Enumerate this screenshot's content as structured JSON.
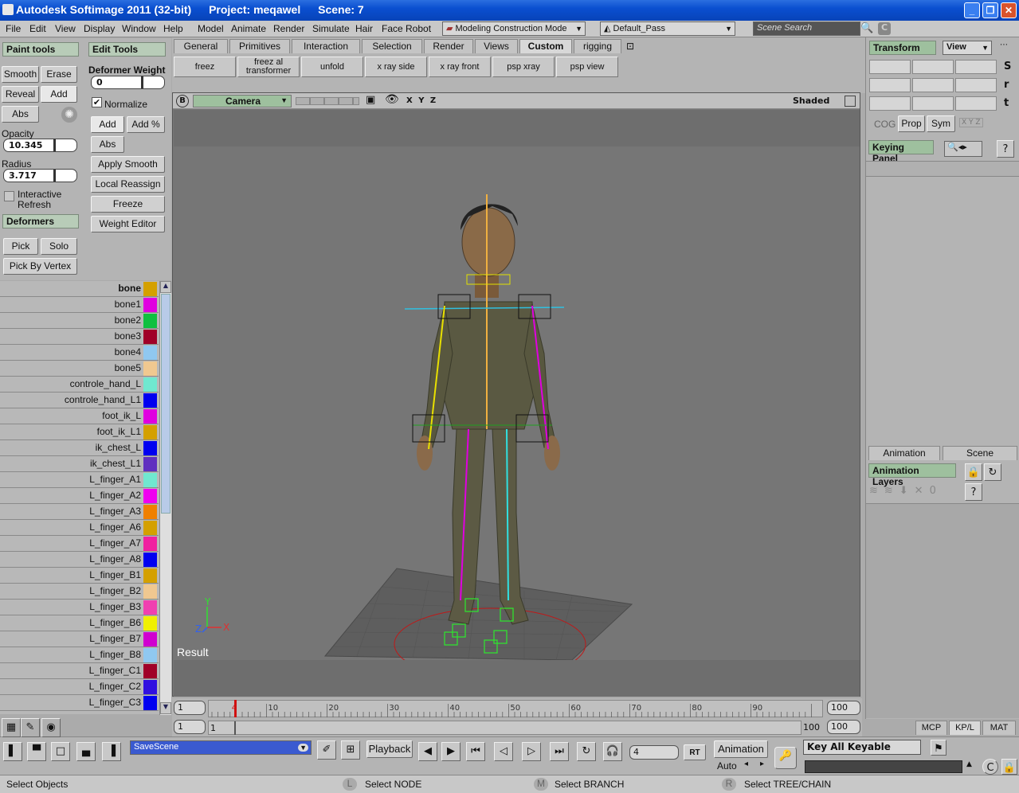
{
  "window": {
    "title": "Autodesk Softimage 2011 (32-bit)",
    "project": "Project: meqawel",
    "scene": "Scene: 7"
  },
  "menu": [
    "File",
    "Edit",
    "View",
    "Display",
    "Window",
    "Help",
    "Model",
    "Animate",
    "Render",
    "Simulate",
    "Hair",
    "Face Robot"
  ],
  "mode_combo": "Modeling Construction Mode",
  "pass_combo": "Default_Pass",
  "scene_search_placeholder": "Scene Search",
  "paint": {
    "paint_tools": "Paint tools",
    "edit_tools": "Edit Tools",
    "smooth": "Smooth",
    "erase": "Erase",
    "reveal": "Reveal",
    "add": "Add",
    "abs": "Abs",
    "deformer_weight_label": "Deformer Weight",
    "deformer_weight_value": "0",
    "normalize": "Normalize",
    "add2": "Add",
    "add_pct": "Add %",
    "abs2": "Abs",
    "opacity_label": "Opacity",
    "opacity_value": "10.345",
    "radius_label": "Radius",
    "radius_value": "3.717",
    "interactive_refresh_1": "Interactive",
    "interactive_refresh_2": "Refresh",
    "apply_smooth": "Apply Smooth",
    "local_reassign": "Local Reassign",
    "freeze": "Freeze",
    "weight_editor": "Weight Editor",
    "deformers": "Deformers",
    "pick": "Pick",
    "solo": "Solo",
    "pick_by_vertex": "Pick By Vertex"
  },
  "bones": [
    {
      "name": "bone",
      "color": "#d4a000"
    },
    {
      "name": "bone1",
      "color": "#e000e0"
    },
    {
      "name": "bone2",
      "color": "#10c040"
    },
    {
      "name": "bone3",
      "color": "#a00028"
    },
    {
      "name": "bone4",
      "color": "#90c8f0"
    },
    {
      "name": "bone5",
      "color": "#f0c890"
    },
    {
      "name": "controle_hand_L",
      "color": "#70e8d0"
    },
    {
      "name": "controle_hand_L1",
      "color": "#0000f0"
    },
    {
      "name": "foot_ik_L",
      "color": "#e000e0"
    },
    {
      "name": "foot_ik_L1",
      "color": "#d4a000"
    },
    {
      "name": "ik_chest_L",
      "color": "#0000f0"
    },
    {
      "name": "ik_chest_L1",
      "color": "#6030c0"
    },
    {
      "name": "L_finger_A1",
      "color": "#70e8d0"
    },
    {
      "name": "L_finger_A2",
      "color": "#f000f0"
    },
    {
      "name": "L_finger_A3",
      "color": "#f08000"
    },
    {
      "name": "L_finger_A6",
      "color": "#d4a000"
    },
    {
      "name": "L_finger_A7",
      "color": "#f020a0"
    },
    {
      "name": "L_finger_A8",
      "color": "#0000f0"
    },
    {
      "name": "L_finger_B1",
      "color": "#d4a000"
    },
    {
      "name": "L_finger_B2",
      "color": "#f0c890"
    },
    {
      "name": "L_finger_B3",
      "color": "#f040b0"
    },
    {
      "name": "L_finger_B6",
      "color": "#f0f000"
    },
    {
      "name": "L_finger_B7",
      "color": "#d000d0"
    },
    {
      "name": "L_finger_B8",
      "color": "#90c8f0"
    },
    {
      "name": "L_finger_C1",
      "color": "#a00028"
    },
    {
      "name": "L_finger_C2",
      "color": "#3010e0"
    },
    {
      "name": "L_finger_C3",
      "color": "#0000f0"
    }
  ],
  "toptabs": [
    "General",
    "Primitives",
    "Interaction",
    "Selection",
    "Render",
    "Views",
    "Custom",
    "rigging"
  ],
  "custom_buttons": [
    "freez",
    "freez al transformer",
    "unfold",
    "x ray side",
    "x ray front",
    "psp xray",
    "psp view"
  ],
  "viewport": {
    "b": "B",
    "camera": "Camera",
    "axes": "X Y Z",
    "shading": "Shaded",
    "result": "Result",
    "gizmo_y": "Y",
    "gizmo_x": "X",
    "gizmo_z": "Z"
  },
  "right": {
    "transform": "Transform",
    "view": "View",
    "s": "S",
    "r": "r",
    "t": "t",
    "cog": "COG",
    "prop": "Prop",
    "sym": "Sym",
    "xyz": "X Y Z",
    "keying_panel": "Keying Panel",
    "animation_tab": "Animation",
    "scene_tab": "Scene",
    "animation_layers": "Animation Layers",
    "mcp": "MCP",
    "kpl": "KP/L",
    "mat": "MAT"
  },
  "timeline": {
    "start": "1",
    "end": "100",
    "ticks": [
      "4",
      "10",
      "20",
      "30",
      "40",
      "50",
      "60",
      "70",
      "80",
      "90"
    ],
    "range_start": "1",
    "range_mid": "1",
    "range_end": "100",
    "range_end2": "100",
    "current_frame": 4
  },
  "bottom": {
    "save_scene": "SaveScene",
    "playback": "Playback",
    "frame": "4",
    "rt": "RT",
    "animation": "Animation",
    "auto": "Auto",
    "key_all": "Key All Keyable"
  },
  "status": {
    "left": "Select Objects",
    "l": "L",
    "node": "Select NODE",
    "m": "M",
    "branch": "Select BRANCH",
    "r": "R",
    "tree": "Select TREE/CHAIN"
  }
}
